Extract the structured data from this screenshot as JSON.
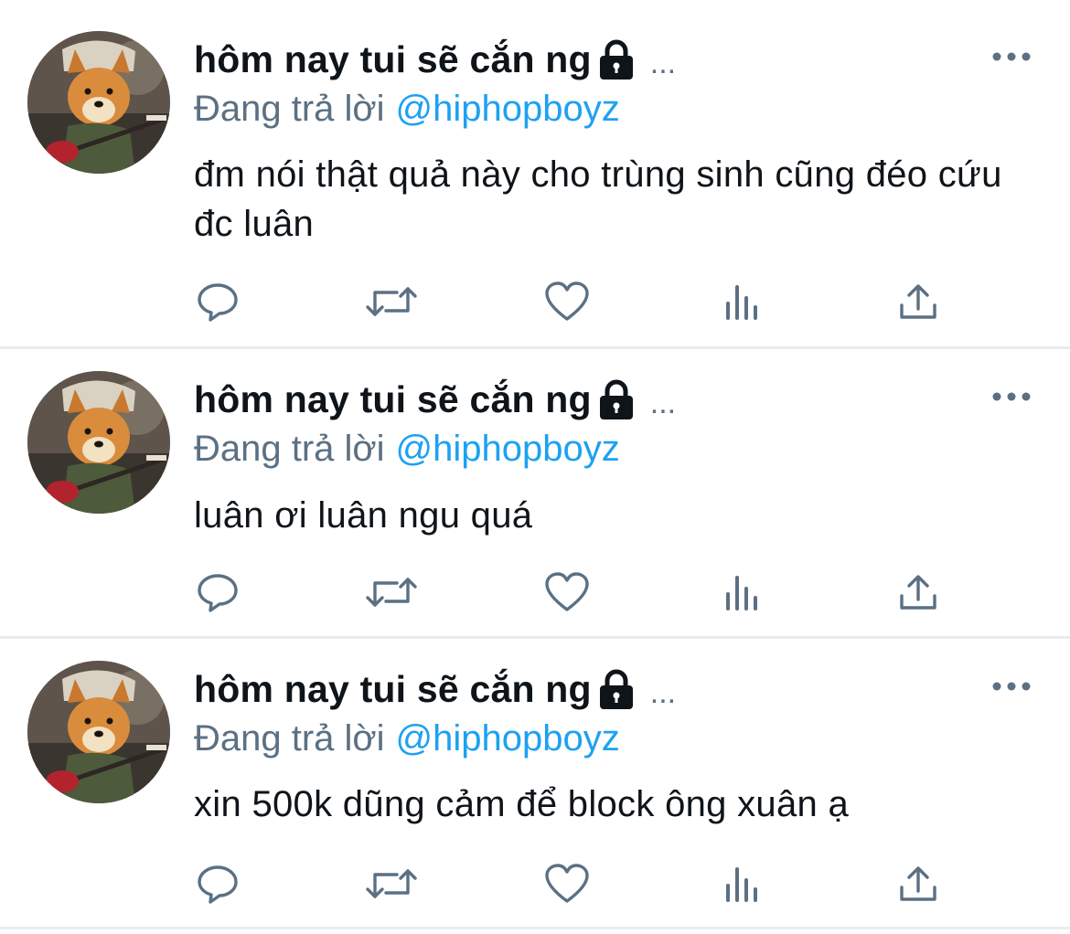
{
  "tweets": [
    {
      "author_name": "hôm nay tui sẽ cắn ng",
      "ellipsis": "...",
      "reply_prefix": "Đang trả lời",
      "reply_handle": "@hiphopboyz",
      "text": "đm nói thật quả này cho trùng sinh cũng đéo cứu đc luân"
    },
    {
      "author_name": "hôm nay tui sẽ cắn ng",
      "ellipsis": "...",
      "reply_prefix": "Đang trả lời",
      "reply_handle": "@hiphopboyz",
      "text": "luân ơi luân ngu quá"
    },
    {
      "author_name": "hôm nay tui sẽ cắn ng",
      "ellipsis": "...",
      "reply_prefix": "Đang trả lời",
      "reply_handle": "@hiphopboyz",
      "text": "xin 500k dũng cảm để block ông xuân ạ"
    }
  ],
  "icons": {
    "lock": "lock-icon",
    "more": "more-horizontal-icon",
    "reply": "reply-icon",
    "retweet": "retweet-icon",
    "like": "like-heart-icon",
    "analytics": "analytics-icon",
    "share": "share-icon",
    "avatar": "avatar-dog-with-guitar"
  },
  "colors": {
    "text": "#0f1419",
    "secondary": "#5b7083",
    "link": "#1da1f2",
    "divider": "#e6ecf0"
  }
}
